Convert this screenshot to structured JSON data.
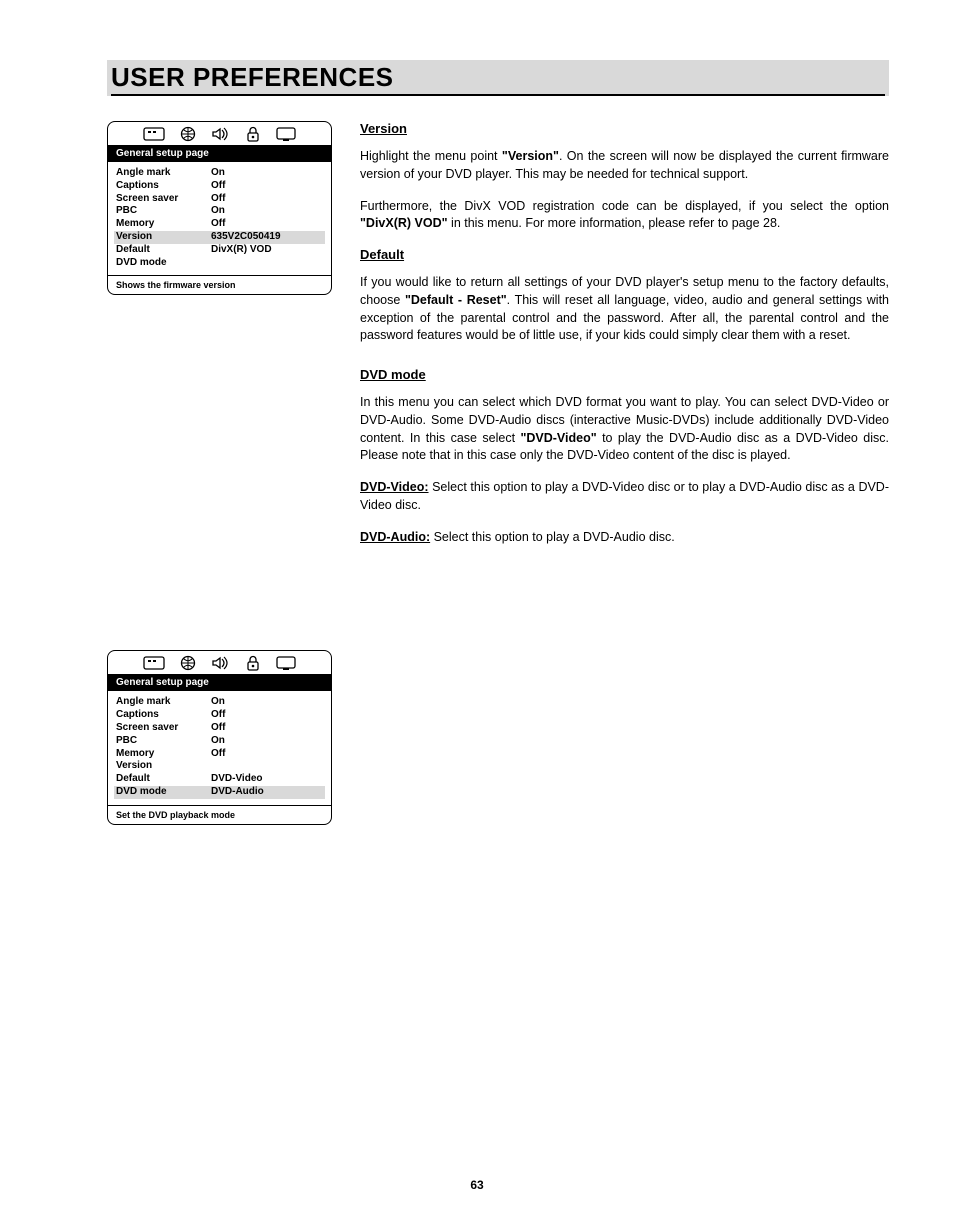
{
  "page_title": "USER PREFERENCES",
  "page_number": "63",
  "osd1": {
    "title": "General setup page",
    "rows": [
      {
        "label": "Angle mark",
        "value": "On",
        "selected": false
      },
      {
        "label": "Captions",
        "value": "Off",
        "selected": false
      },
      {
        "label": "Screen saver",
        "value": "Off",
        "selected": false
      },
      {
        "label": "PBC",
        "value": "On",
        "selected": false
      },
      {
        "label": "Memory",
        "value": "Off",
        "selected": false
      },
      {
        "label": "Version",
        "value": "635V2C050419",
        "selected": true
      },
      {
        "label": "Default",
        "value": "DivX(R) VOD",
        "selected": false
      },
      {
        "label": "DVD mode",
        "value": "",
        "selected": false
      }
    ],
    "footer": "Shows the firmware version"
  },
  "osd2": {
    "title": "General setup page",
    "rows": [
      {
        "label": "Angle mark",
        "value": "On",
        "selected": false
      },
      {
        "label": "Captions",
        "value": "Off",
        "selected": false
      },
      {
        "label": "Screen saver",
        "value": "Off",
        "selected": false
      },
      {
        "label": "PBC",
        "value": "On",
        "selected": false
      },
      {
        "label": "Memory",
        "value": "Off",
        "selected": false
      },
      {
        "label": "Version",
        "value": "",
        "selected": false
      },
      {
        "label": "Default",
        "value": "DVD-Video",
        "selected": false
      },
      {
        "label": "DVD mode",
        "value": "DVD-Audio",
        "selected": true
      }
    ],
    "footer": "Set the DVD playback mode"
  },
  "sections": {
    "version": {
      "heading": "Version",
      "p1a": "Highlight the menu point ",
      "p1b": "\"Version\"",
      "p1c": ". On the screen will now be displayed the current firmware version of your DVD player. This may be needed for technical support.",
      "p2a": "Furthermore, the DivX VOD registration code can be displayed, if you select the option ",
      "p2b": "\"DivX(R) VOD\"",
      "p2c": " in this menu. For more information, please refer to page 28."
    },
    "default": {
      "heading": "Default",
      "p1a": "If you would like to return all settings of your DVD player's setup menu to the factory defaults, choose ",
      "p1b": "\"Default - Reset\"",
      "p1c": ". This will reset all language, video, audio and general settings with exception of the parental control and the password. After all, the parental control and the password features would be of little use, if your kids could simply clear them with a reset."
    },
    "dvdmode": {
      "heading": "DVD mode",
      "p1a": "In this menu you can select which DVD format you want to play. You can select DVD-Video or DVD-Audio. Some DVD-Audio discs (interactive Music-DVDs) include additionally DVD-Video content. In this case select ",
      "p1b": "\"DVD-Video\"",
      "p1c": " to play the DVD-Audio disc as a DVD-Video disc. Please note that in this case only the DVD-Video content of the disc is played.",
      "p2a": "DVD-Video:",
      "p2b": " Select this option to play a DVD-Video disc or to play a DVD-Audio disc as a DVD-Video disc.",
      "p3a": "DVD-Audio:",
      "p3b": " Select this option to play a DVD-Audio disc."
    }
  }
}
